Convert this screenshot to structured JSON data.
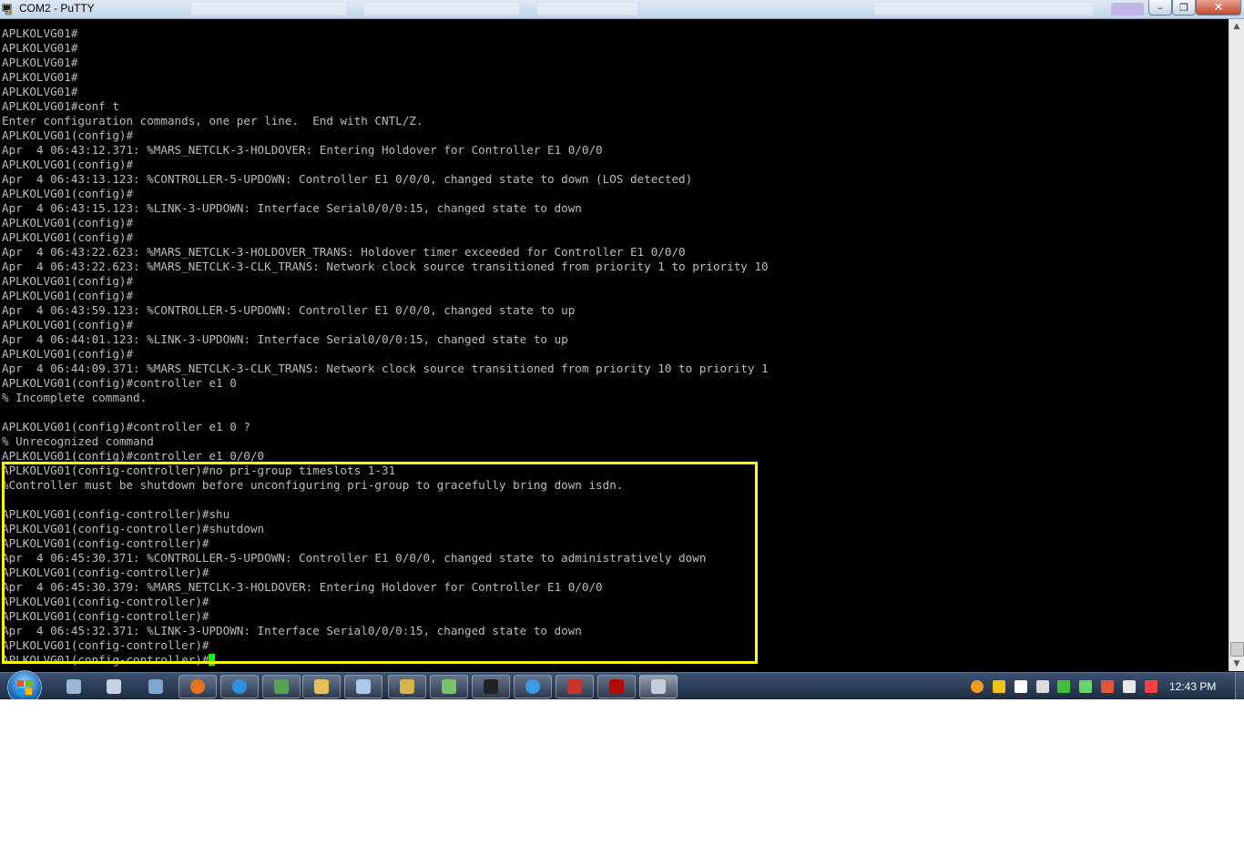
{
  "window": {
    "title": "COM2 - PuTTY",
    "minimize_glyph": "–",
    "maximize_glyph": "❐",
    "close_glyph": "✕"
  },
  "terminal": {
    "lines": [
      "APLKOLVG01#",
      "APLKOLVG01#",
      "APLKOLVG01#",
      "APLKOLVG01#",
      "APLKOLVG01#",
      "APLKOLVG01#conf t",
      "Enter configuration commands, one per line.  End with CNTL/Z.",
      "APLKOLVG01(config)#",
      "Apr  4 06:43:12.371: %MARS_NETCLK-3-HOLDOVER: Entering Holdover for Controller E1 0/0/0",
      "APLKOLVG01(config)#",
      "Apr  4 06:43:13.123: %CONTROLLER-5-UPDOWN: Controller E1 0/0/0, changed state to down (LOS detected)",
      "APLKOLVG01(config)#",
      "Apr  4 06:43:15.123: %LINK-3-UPDOWN: Interface Serial0/0/0:15, changed state to down",
      "APLKOLVG01(config)#",
      "APLKOLVG01(config)#",
      "Apr  4 06:43:22.623: %MARS_NETCLK-3-HOLDOVER_TRANS: Holdover timer exceeded for Controller E1 0/0/0",
      "Apr  4 06:43:22.623: %MARS_NETCLK-3-CLK_TRANS: Network clock source transitioned from priority 1 to priority 10",
      "APLKOLVG01(config)#",
      "APLKOLVG01(config)#",
      "Apr  4 06:43:59.123: %CONTROLLER-5-UPDOWN: Controller E1 0/0/0, changed state to up",
      "APLKOLVG01(config)#",
      "Apr  4 06:44:01.123: %LINK-3-UPDOWN: Interface Serial0/0/0:15, changed state to up",
      "APLKOLVG01(config)#",
      "Apr  4 06:44:09.371: %MARS_NETCLK-3-CLK_TRANS: Network clock source transitioned from priority 10 to priority 1",
      "APLKOLVG01(config)#controller e1 0",
      "% Incomplete command.",
      "",
      "APLKOLVG01(config)#controller e1 0 ?",
      "% Unrecognized command",
      "APLKOLVG01(config)#controller e1 0/0/0",
      "APLKOLVG01(config-controller)#no pri-group timeslots 1-31",
      "%Controller must be shutdown before unconfiguring pri-group to gracefully bring down isdn.",
      "",
      "APLKOLVG01(config-controller)#shu",
      "APLKOLVG01(config-controller)#shutdown",
      "APLKOLVG01(config-controller)#",
      "Apr  4 06:45:30.371: %CONTROLLER-5-UPDOWN: Controller E1 0/0/0, changed state to administratively down",
      "APLKOLVG01(config-controller)#",
      "Apr  4 06:45:30.379: %MARS_NETCLK-3-HOLDOVER: Entering Holdover for Controller E1 0/0/0",
      "APLKOLVG01(config-controller)#",
      "APLKOLVG01(config-controller)#",
      "Apr  4 06:45:32.371: %LINK-3-UPDOWN: Interface Serial0/0/0:15, changed state to down",
      "APLKOLVG01(config-controller)#"
    ],
    "prompt": "APLKOLVG01(config-controller)#"
  },
  "taskbar": {
    "apps": [
      {
        "name": "remote-desktop-icon",
        "color": "#9ab7d8"
      },
      {
        "name": "calculator-icon",
        "color": "#c7d3e2"
      },
      {
        "name": "vnc-viewer-icon",
        "color": "#7fa6cf"
      },
      {
        "name": "firefox-icon",
        "color": "#e8731c"
      },
      {
        "name": "internet-explorer-icon",
        "color": "#2f8fe0"
      },
      {
        "name": "image-viewer-icon",
        "color": "#5aa055"
      },
      {
        "name": "file-explorer-icon",
        "color": "#e6c15a"
      },
      {
        "name": "notepad-icon",
        "color": "#a9c8ea"
      },
      {
        "name": "network-tool-icon",
        "color": "#d6b64a"
      },
      {
        "name": "messenger-icon",
        "color": "#7bc36b"
      },
      {
        "name": "command-prompt-icon",
        "color": "#222222"
      },
      {
        "name": "browser-globe-icon",
        "color": "#3a9be6"
      },
      {
        "name": "printer-fax-icon",
        "color": "#c9372c"
      },
      {
        "name": "acrobat-reader-icon",
        "color": "#b30b00"
      },
      {
        "name": "putty-icon",
        "color": "#c5cfdb"
      }
    ],
    "tray_icons": [
      {
        "name": "sametime-icon",
        "color": "#f39a1e"
      },
      {
        "name": "security-shield-icon",
        "color": "#f1c40f"
      },
      {
        "name": "signal-bars-icon",
        "color": "#ffffff"
      },
      {
        "name": "lock-icon",
        "color": "#dcdcdc"
      },
      {
        "name": "network-monitor-icon",
        "color": "#3fbf3f"
      },
      {
        "name": "network-connection-icon",
        "color": "#6bd36b"
      },
      {
        "name": "volume-icon",
        "color": "#e05a3a"
      },
      {
        "name": "usb-device-icon",
        "color": "#e8e8e8"
      },
      {
        "name": "mute-speaker-icon",
        "color": "#ff4040"
      }
    ],
    "clock": "12:43 PM"
  },
  "colors": {
    "terminal_text": "#bbbbbb",
    "cursor": "#00ff00",
    "highlight": "#ffff00"
  }
}
